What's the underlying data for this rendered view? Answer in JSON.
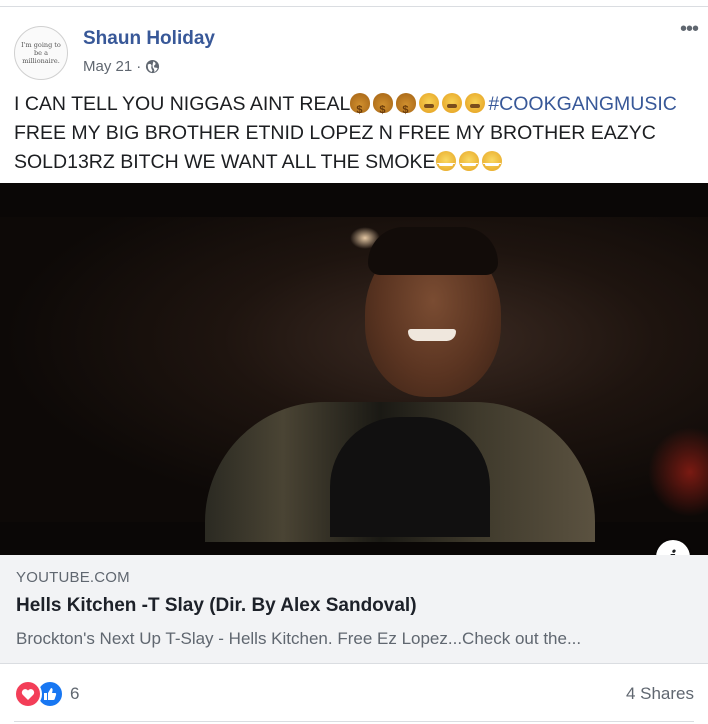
{
  "post": {
    "author": "Shaun Holiday",
    "avatar_text": "I'm going to be a\nmillionaire.",
    "date": "May 21",
    "separator": "·",
    "privacy_icon": "globe-icon",
    "more_icon": "more-options-icon",
    "text_part1": "I CAN TELL YOU NIGGAS AINT REAL",
    "hashtag": "#COOKGANGMUSIC",
    "text_part2": "FREE MY BIG BROTHER ETNID LOPEZ N FREE MY BROTHER EAZYC SOLD13RZ BITCH WE WANT ALL THE SMOKE",
    "emojis": [
      "money-bag",
      "money-bag",
      "money-bag",
      "nauseated-face",
      "nauseated-face",
      "nauseated-face",
      "steam-face",
      "steam-face",
      "steam-face"
    ]
  },
  "link": {
    "domain": "YOUTUBE.COM",
    "title": "Hells Kitchen -T Slay (Dir. By Alex Sandoval)",
    "description": "Brockton's Next Up T-Slay - Hells Kitchen. Free Ez Lopez...Check out the...",
    "info_icon": "info-icon"
  },
  "footer": {
    "reaction_count": "6",
    "shares": "4 Shares",
    "reaction_icons": [
      "love-icon",
      "like-icon"
    ]
  },
  "colors": {
    "author_blue": "#385898",
    "love_red": "#f33e58",
    "like_blue": "#1877f2",
    "meta_gray": "#606770"
  }
}
